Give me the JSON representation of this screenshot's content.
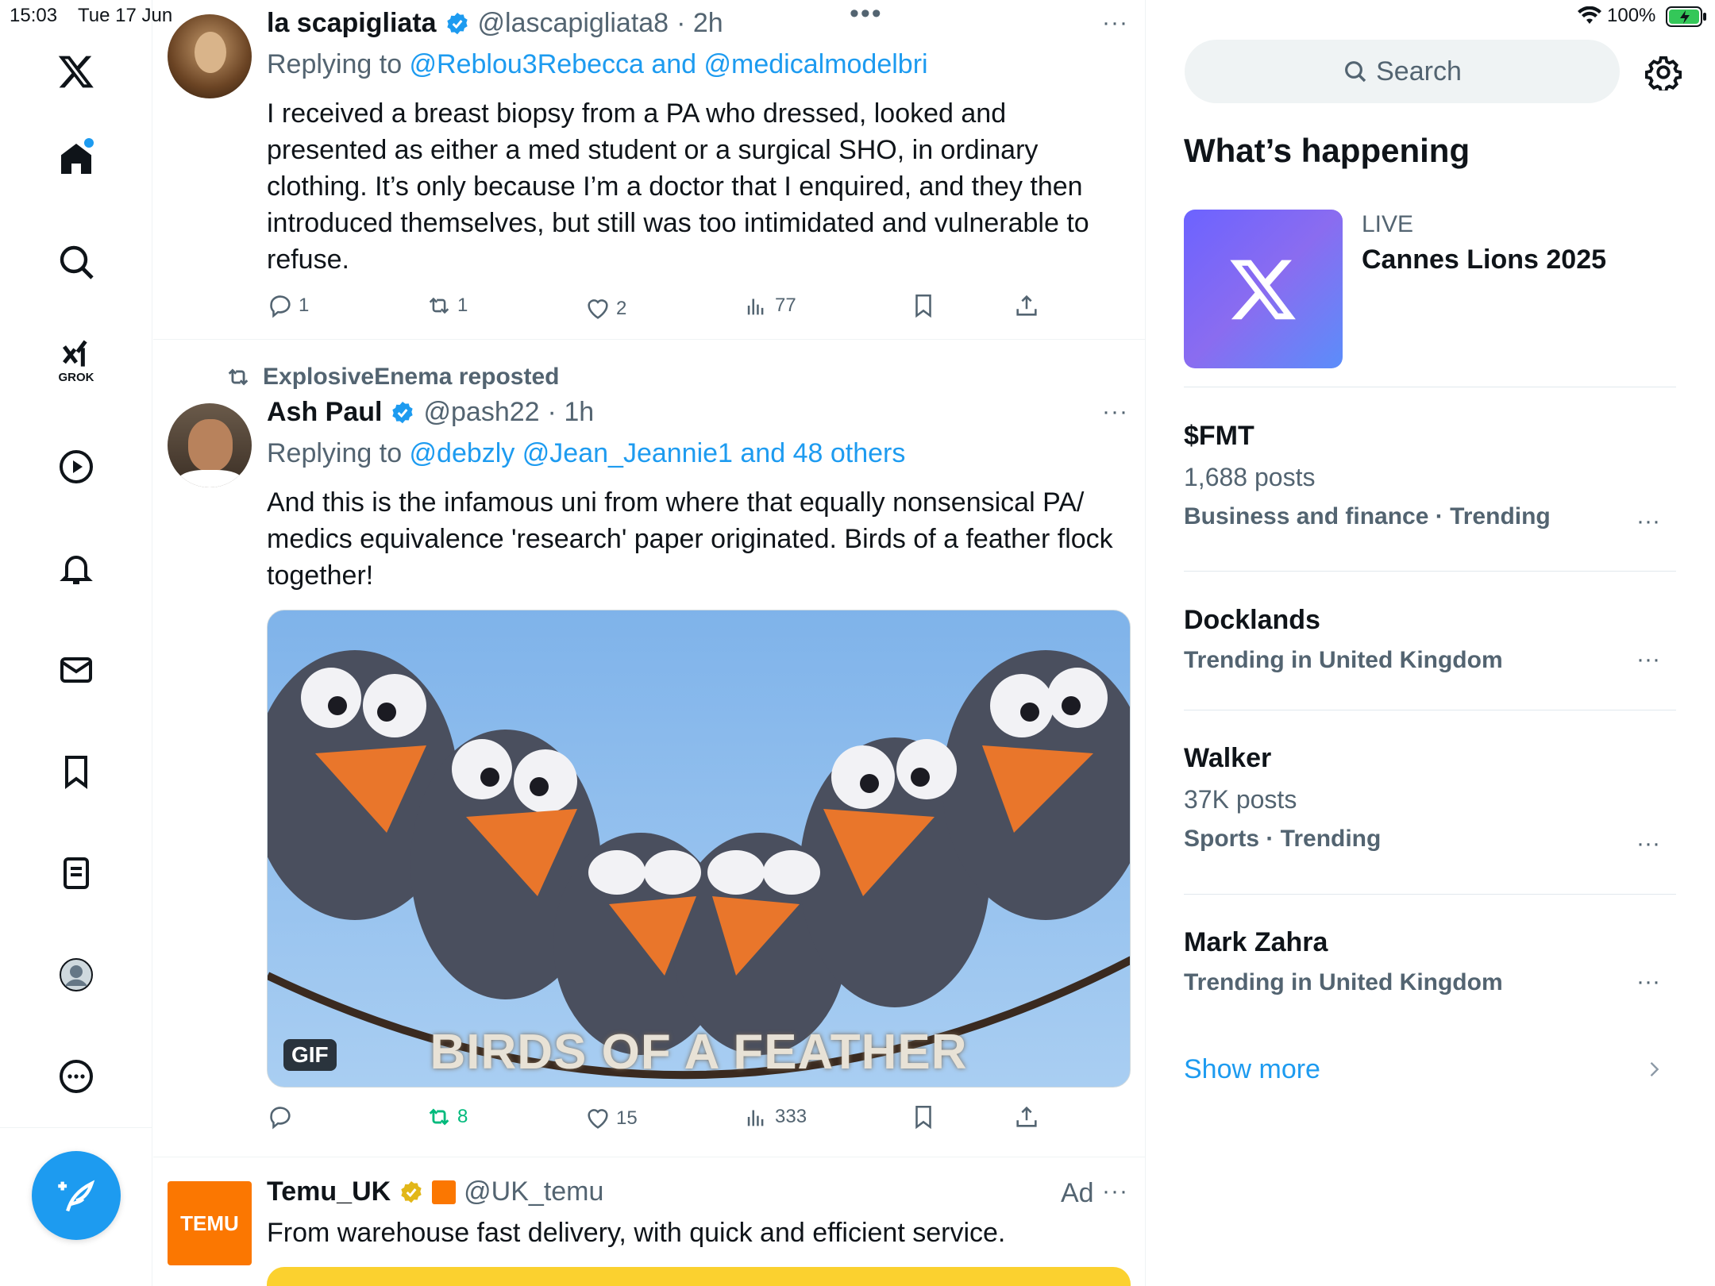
{
  "status_bar": {
    "time": "15:03",
    "date": "Tue 17 Jun",
    "battery": "100%"
  },
  "nav": {
    "grok_label": "GROK"
  },
  "tweets": [
    {
      "name": "la scapigliata",
      "handle": "@lascapigliata8",
      "time": "· 2h",
      "replying_prefix": "Replying to ",
      "replying_to": "@Reblou3Rebecca and @medicalmodelbri",
      "text": "I received a breast biopsy from a PA who dressed, looked and presented as either a med student or a surgical SHO, in ordinary clothing. It’s only because I’m a doctor that I enquired, and they then introduced themselves, but still was too intimidated and vulnerable to refuse.",
      "replies": "1",
      "reposts": "1",
      "likes": "2",
      "views": "77"
    },
    {
      "repost_label": "ExplosiveEnema reposted",
      "name": "Ash Paul",
      "handle": "@pash22",
      "time": "· 1h",
      "replying_prefix": "Replying to ",
      "replying_to": "@debzly @Jean_Jeannie1 and 48 others",
      "text": "And this is the infamous uni from where that equally nonsensical PA/ medics equivalence 'research' paper originated. Birds of a feather flock together!",
      "media_caption": "BIRDS OF A FEATHER",
      "gif_badge": "GIF",
      "replies": "",
      "reposts": "8",
      "likes": "15",
      "views": "333"
    },
    {
      "name": "Temu_UK",
      "handle": "@UK_temu",
      "ad_label": "Ad",
      "avatar_text": "TEMU",
      "text": "From warehouse fast delivery, with quick and efficient service."
    }
  ],
  "sidebar": {
    "search_placeholder": "Search",
    "section_title": "What’s happening",
    "featured": {
      "label": "LIVE",
      "title": "Cannes Lions 2025"
    },
    "trends": [
      {
        "title": "$FMT",
        "posts": "1,688 posts",
        "category": "Business and finance · Trending"
      },
      {
        "title": "Docklands",
        "posts": "",
        "category": "Trending in United Kingdom"
      },
      {
        "title": "Walker",
        "posts": "37K posts",
        "category": "Sports · Trending"
      },
      {
        "title": "Mark Zahra",
        "posts": "",
        "category": "Trending in United Kingdom"
      }
    ],
    "show_more": "Show more"
  },
  "colors": {
    "accent": "#1d9bf0",
    "repost_active": "#00ba7c",
    "text_secondary": "#536471"
  }
}
